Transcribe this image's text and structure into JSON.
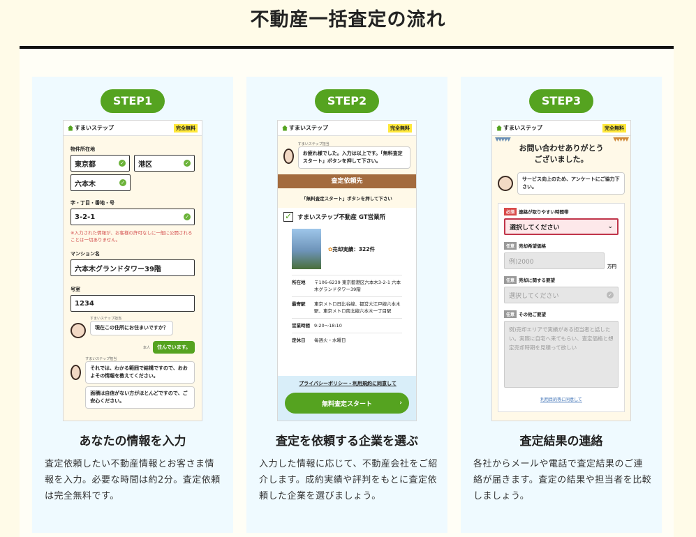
{
  "page_title": "不動産一括査定の流れ",
  "cards": [
    {
      "step": "STEP1",
      "title": "あなたの情報を入力",
      "desc": "査定依頼したい不動産情報とお客さま情報を入力。必要な時間は約2分。査定依頼は完全無料です。"
    },
    {
      "step": "STEP2",
      "title": "査定を依頼する企業を選ぶ",
      "desc": "入力した情報に応じて、不動産会社をご紹介します。成約実績や評判をもとに査定依頼した企業を選びましょう。"
    },
    {
      "step": "STEP3",
      "title": "査定結果の連絡",
      "desc": "各社からメールや電話で査定結果のご連絡が届きます。査定の結果や担当者を比較しましょう。"
    }
  ],
  "mock": {
    "brand": "すまいステップ",
    "free": "完全無料",
    "s1": {
      "lbl_location": "物件所在地",
      "pref": "東京都",
      "ward": "港区",
      "town": "六本木",
      "lbl_address": "字・丁目・番地・号",
      "address": "3-2-1",
      "notice": "※入力された情報が、お客様の許可なしに一般に公開されることは一切ありません。",
      "lbl_mansion": "マンション名",
      "mansion": "六本木グランドタワー39階",
      "lbl_room": "号室",
      "room": "1234",
      "agent_name": "すまいステップ担当",
      "q1": "現在この住所にお住まいですか？",
      "reply_name": "本人",
      "a1": "住んでいます。",
      "q2": "それでは、わかる範囲で結構ですので、おおよその情報を教えてください。",
      "q3": "面積は自信がない方がほとんどですので、ご安心ください。"
    },
    "s2": {
      "agent_name": "すまいステップ担当",
      "greet": "お疲れ様でした。入力は以上です。「無料査定スタート」ボタンを押して下さい。",
      "bar": "査定依頼先",
      "sub": "「無料査定スタート」ボタンを押して下さい",
      "company": "すまいステップ不動産 GT営業所",
      "record": "売却実績：322件",
      "rows": [
        {
          "k": "所在地",
          "v": "〒106-6239 東京都港区六本木3-2-1 六本木グランドタワー39階"
        },
        {
          "k": "最寄駅",
          "v": "東京メトロ日比谷線、都営大江戸線六本木駅、東京メトロ南北線六本木一丁目駅"
        },
        {
          "k": "営業時間",
          "v": "9:20〜18:10"
        },
        {
          "k": "定休日",
          "v": "毎週火・水曜日"
        }
      ],
      "agree": "プライバシーポリシー・利用規約に同意して",
      "cta": "無料査定スタート"
    },
    "s3": {
      "thanks": "お問い合わせありがとうございました。",
      "survey": "サービス向上のため、アンケートにご協力下さい。",
      "req_tag": "必須",
      "opt_tag": "任意",
      "lbl_time": "連絡が取りやすい時間帯",
      "time_val": "選択してください",
      "lbl_price": "売却希望価格",
      "price_ph": "例)2000",
      "unit": "万円",
      "lbl_req": "売却に関する要望",
      "req_ph": "選択してください",
      "lbl_other": "その他ご要望",
      "other_ph": "例)売却エリアで実績がある担当者と話したい。実際に自宅へ来てもらい、査定価格と想定売却時期を見積って欲しい",
      "footer": "利用目的等に同意して"
    }
  }
}
